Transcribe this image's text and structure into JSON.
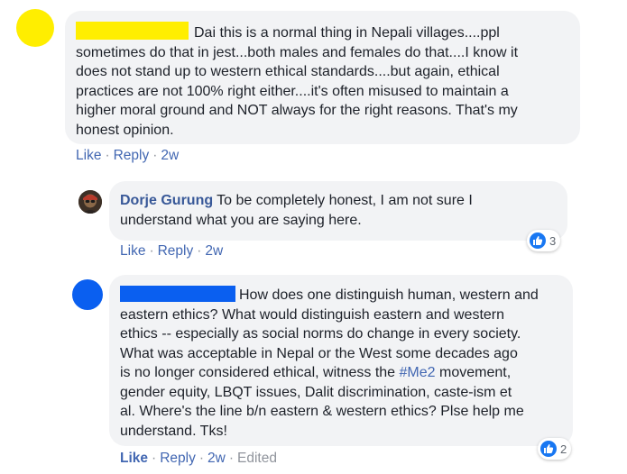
{
  "colors": {
    "link": "#4267b2",
    "author": "#385898",
    "bubble_bg": "#f2f3f5",
    "meta_text": "#606770",
    "redaction_yellow": "#ffee00",
    "redaction_blue": "#0a5ff0",
    "like_badge": "#1877f2"
  },
  "comments": [
    {
      "avatar_icon": "redacted-yellow-avatar",
      "author": "",
      "text_lines": [
        "Dai this is a normal thing in Nepali villages....ppl",
        "sometimes do that in jest...both males and females do that....I know it",
        "does not stand up to western ethical standards....but again, ethical",
        "practices are not 100% right either....it's often misused to maintain a",
        "higher moral ground and NOT always for the right reasons. That's my",
        "honest opinion."
      ],
      "actions": {
        "like": "Like",
        "reply": "Reply",
        "time": "2w"
      }
    },
    {
      "avatar_icon": "profile-photo",
      "author": "Dorje Gurung",
      "text_lines": [
        "To be completely honest, I am not sure I",
        "understand what you are saying here."
      ],
      "actions": {
        "like": "Like",
        "reply": "Reply",
        "time": "2w"
      },
      "reactions": {
        "icon": "like-icon",
        "count": "3"
      }
    },
    {
      "avatar_icon": "redacted-blue-avatar",
      "author": "",
      "text_lines": [
        "How does one distinguish human, western and",
        "eastern ethics? What would distinguish eastern and western",
        "ethics -- especially as social norms do change in every society.",
        "What was acceptable in Nepal or the West some decades ago",
        "is no longer considered ethical, witness the",
        "#Me2",
        "movement,",
        "gender equity, LBQT issues, Dalit discrimination, caste-ism et",
        "al. Where's the line b/n eastern & western ethics? Plse help me",
        "understand. Tks!"
      ],
      "actions": {
        "like": "Like",
        "reply": "Reply",
        "time": "2w",
        "edited": "Edited"
      },
      "reactions": {
        "icon": "like-icon",
        "count": "2"
      }
    }
  ]
}
